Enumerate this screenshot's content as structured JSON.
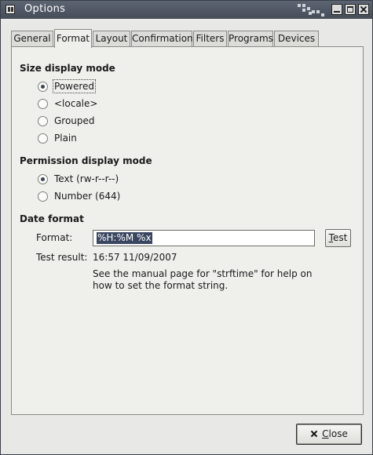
{
  "window": {
    "title": "Options"
  },
  "tabs": [
    "General",
    "Format",
    "Layout",
    "Confirmation",
    "Filters",
    "Programs",
    "Devices"
  ],
  "active_tab": "Format",
  "size_display": {
    "heading": "Size display mode",
    "options": [
      "Powered",
      "<locale>",
      "Grouped",
      "Plain"
    ],
    "selected": "Powered"
  },
  "permission_display": {
    "heading": "Permission display mode",
    "options": [
      "Text (rw-r--r--)",
      "Number (644)"
    ],
    "selected": "Text (rw-r--r--)"
  },
  "date_format": {
    "heading": "Date format",
    "format_label": "Format:",
    "format_value": "%H:%M %x",
    "test_button_prefix": "",
    "test_button_mnemonic": "T",
    "test_button_rest": "est",
    "test_result_label": "Test result:",
    "test_result_value": "16:57 11/09/2007",
    "help_text": "See the manual page for \"strftime\" for help on how to set the format string."
  },
  "footer": {
    "close_mnemonic": "C",
    "close_rest": "lose",
    "close_icon": "close-x-icon"
  }
}
